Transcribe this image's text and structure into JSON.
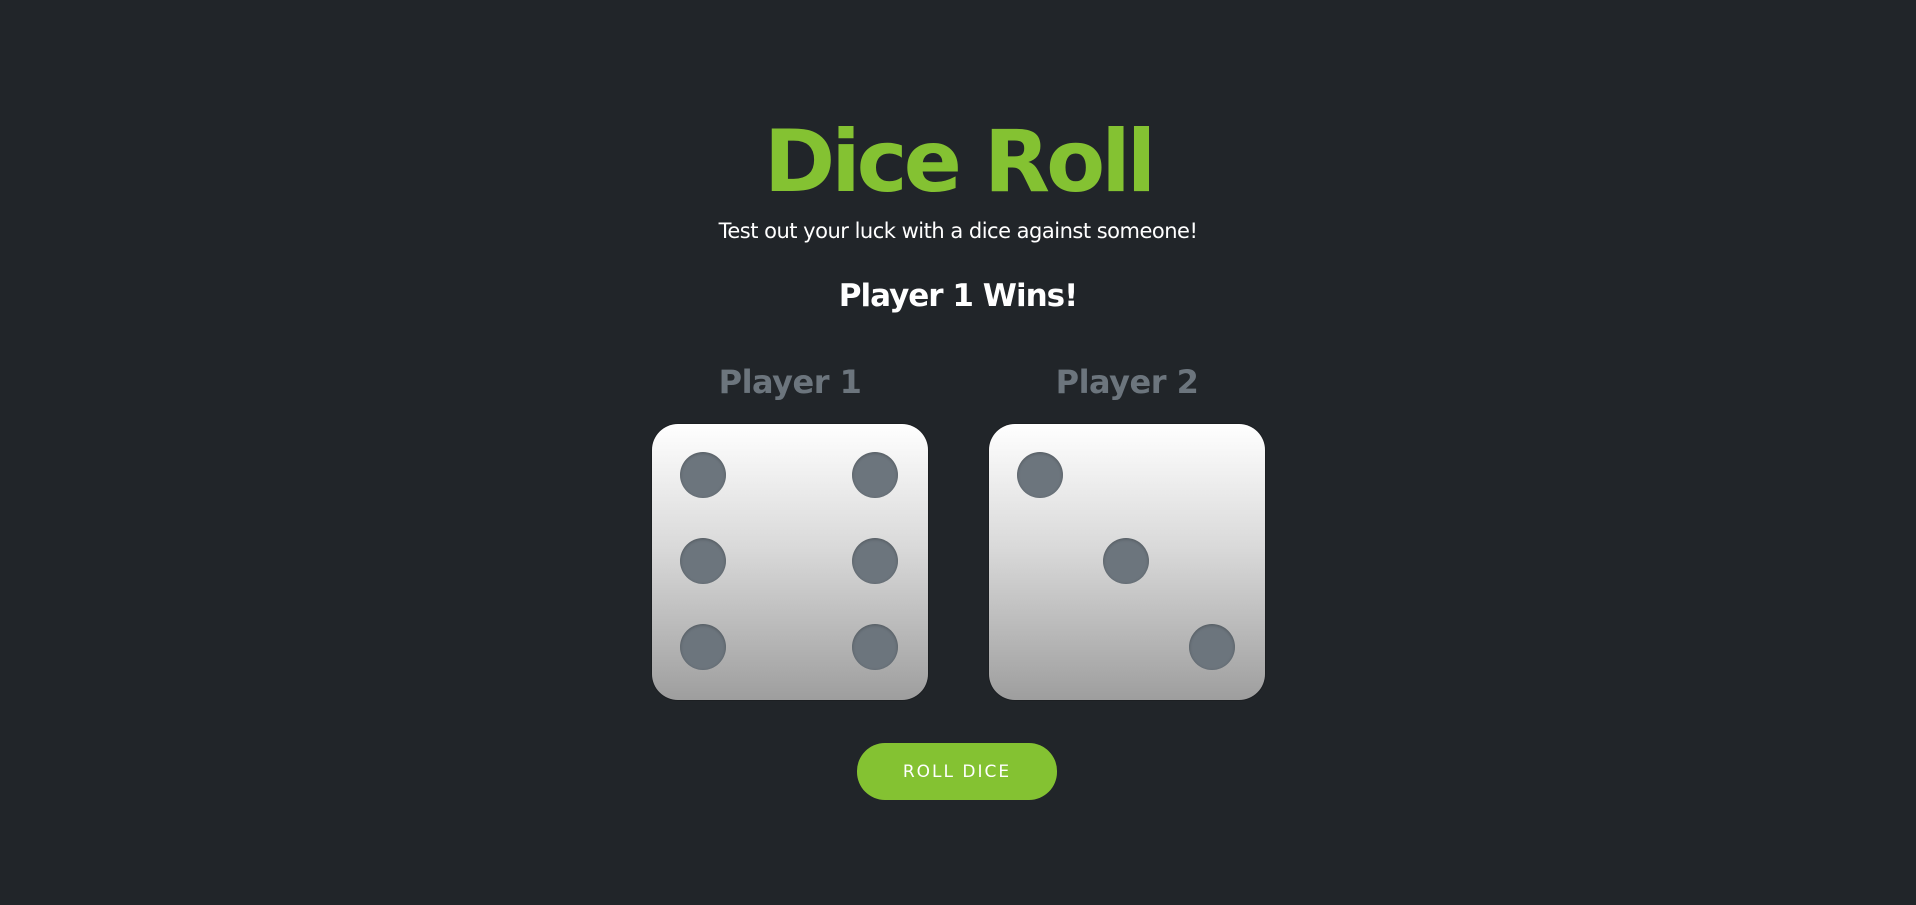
{
  "header": {
    "title": "Dice Roll",
    "subtitle": "Test out your luck with a dice against someone!"
  },
  "result_text": "Player 1 Wins!",
  "players": [
    {
      "name": "Player 1",
      "die_value": 6
    },
    {
      "name": "Player 2",
      "die_value": 3
    }
  ],
  "roll_button_label": "ROLL DICE",
  "colors": {
    "accent": "#84c232",
    "background": "#212529",
    "muted": "#6c757d",
    "text": "#ffffff",
    "pip": "#6c757d"
  }
}
